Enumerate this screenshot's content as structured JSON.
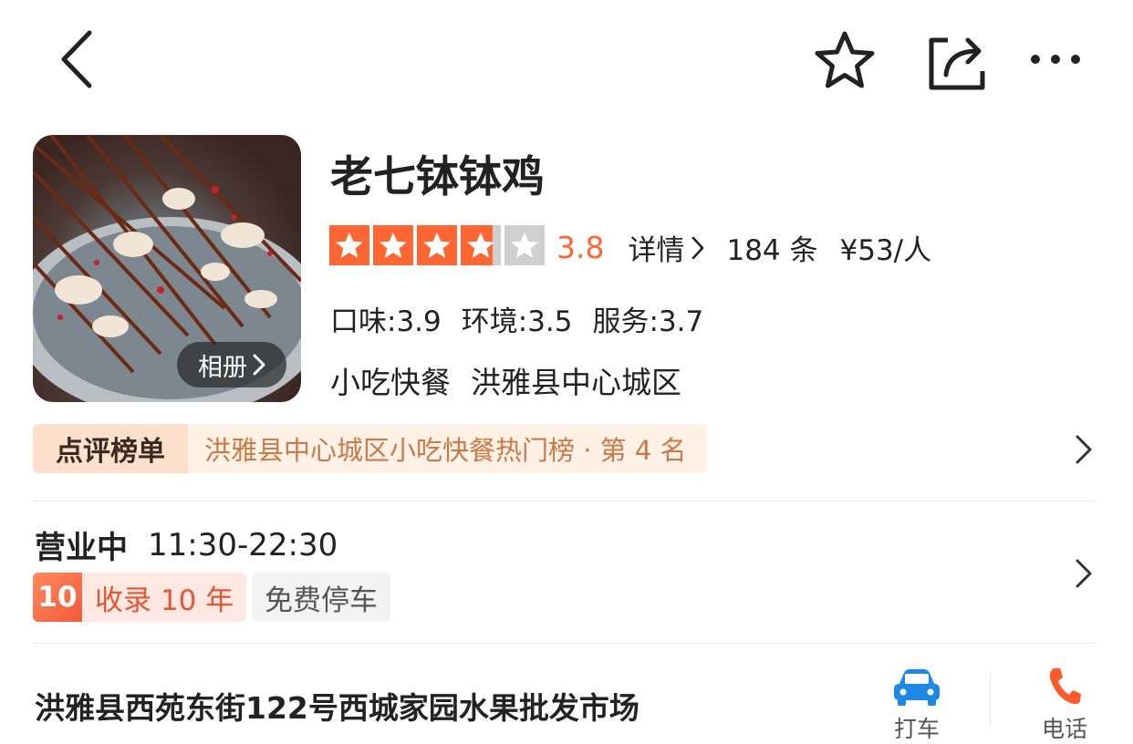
{
  "header": {
    "back_icon": "chevron-left-icon",
    "favorite_icon": "star-outline-icon",
    "share_icon": "share-icon",
    "more_icon": "more-dots-icon"
  },
  "shop": {
    "name": "老七钵钵鸡",
    "album_label": "相册",
    "rating": "3.8",
    "stars_value": 3.8,
    "details_label": "详情",
    "review_count": "184 条",
    "price_per_person": "¥53/人",
    "scores": [
      "口味:3.9",
      "环境:3.5",
      "服务:3.7"
    ],
    "category": "小吃快餐",
    "district": "洪雅县中心城区"
  },
  "ranking": {
    "label": "点评榜单",
    "text": "洪雅县中心城区小吃快餐热门榜 · 第 4 名"
  },
  "business": {
    "status": "营业中",
    "hours": "11:30-22:30",
    "years_number": "10",
    "years_text": "收录 10 年",
    "parking": "免费停车"
  },
  "location": {
    "address": "洪雅县西苑东街122号西城家园水果批发市场",
    "taxi_label": "打车",
    "phone_label": "电话"
  },
  "colors": {
    "star_active": "#ff6633",
    "star_inactive": "#cfcfcf",
    "rating": "#ff6633",
    "rank_text": "#c97a47"
  }
}
